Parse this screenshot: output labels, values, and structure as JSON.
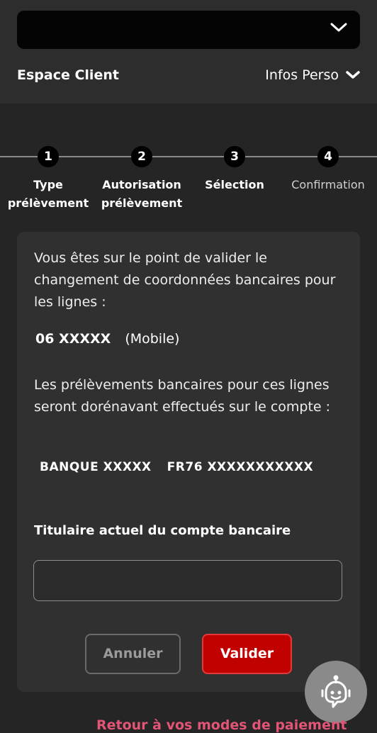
{
  "header": {
    "espace_client": "Espace Client",
    "infos_perso": "Infos Perso"
  },
  "stepper": {
    "steps": [
      {
        "number": "1",
        "label_line1": "Type",
        "label_line2": "prélèvement"
      },
      {
        "number": "2",
        "label_line1": "Autorisation",
        "label_line2": "prélèvement"
      },
      {
        "number": "3",
        "label_line1": "Sélection",
        "label_line2": ""
      },
      {
        "number": "4",
        "label_line1": "Confirmation",
        "label_line2": ""
      }
    ],
    "current_step": 4
  },
  "card": {
    "intro": "Vous êtes sur le point de valider le changement de coordonnées bancaires pour les lignes :",
    "line_number": "06 XXXXX",
    "line_type": "(Mobile)",
    "info": "Les prélèvements bancaires pour ces lignes seront dorénavant effectués sur le compte :",
    "bank_name": "BANQUE XXXXX",
    "iban": "FR76 XXXXXXXXXXX",
    "holder_label": "Titulaire actuel du compte bancaire",
    "holder_value": "",
    "cancel_label": "Annuler",
    "validate_label": "Valider"
  },
  "footer": {
    "retour": "Retour à vos modes de paiement"
  },
  "colors": {
    "accent_red": "#c10000",
    "link_pink": "#e25577"
  },
  "icons": {
    "top_select": "chevron-down-icon",
    "infos_perso": "chevron-down-icon",
    "chatbot": "chatbot-icon"
  }
}
